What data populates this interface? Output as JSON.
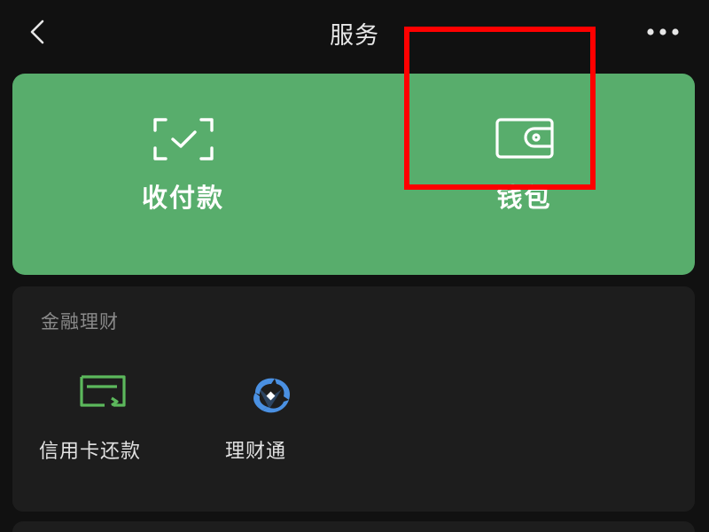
{
  "header": {
    "title": "服务",
    "back_icon": "chevron-left-icon",
    "more_icon": "more-horizontal-icon"
  },
  "pay_card": {
    "background_color": "#58ad6c",
    "receive_pay": {
      "label": "收付款",
      "icon": "scan-check-icon"
    },
    "wallet": {
      "label": "钱包",
      "icon": "wallet-icon"
    },
    "highlight_color": "#ff0000"
  },
  "finance": {
    "title": "金融理财",
    "items": [
      {
        "label": "信用卡还款",
        "icon": "credit-card-icon",
        "color": "#5cb85c"
      },
      {
        "label": "理财通",
        "icon": "wealth-icon",
        "color": "#4a90e2"
      }
    ]
  }
}
